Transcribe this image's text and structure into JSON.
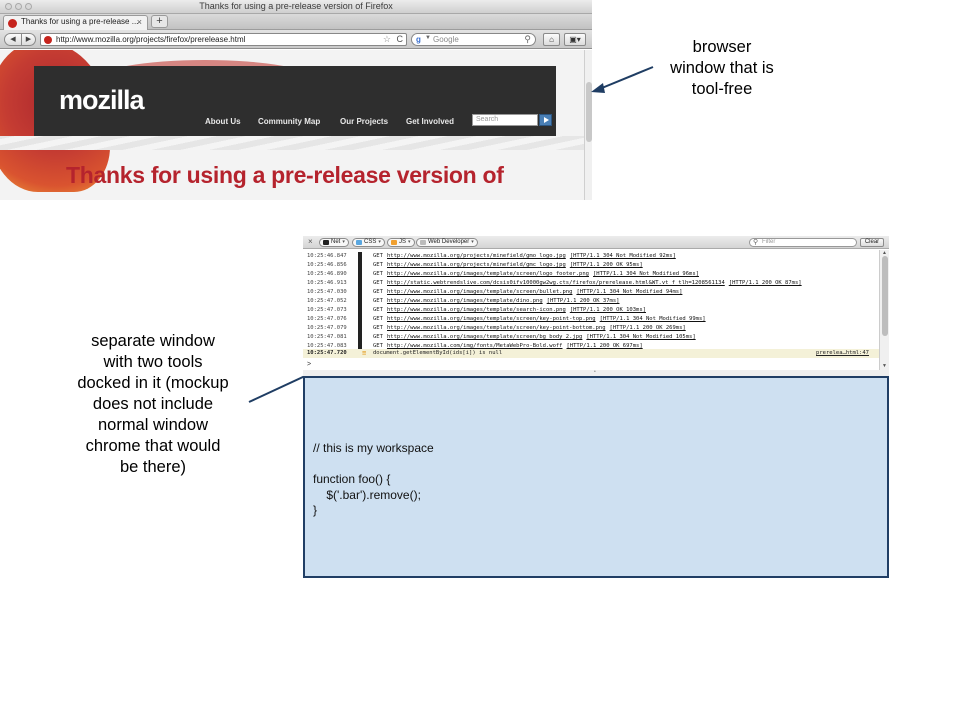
{
  "browser": {
    "window_title": "Thanks for using a pre-release version of Firefox",
    "tab_title": "Thanks for using a pre-release ...",
    "tab_close": "×",
    "new_tab": "+",
    "back": "◀",
    "forward": "▶",
    "url": "http://www.mozilla.org/projects/firefox/prerelease.html",
    "star": "☆",
    "reload": "C",
    "search_engine_icon": "g-icon",
    "search_placeholder": "Google",
    "home_icon": "⌂",
    "menu_icon": "▣▾",
    "page": {
      "logo": "mozilla",
      "nav": [
        "About Us",
        "Community Map",
        "Our Projects",
        "Get Involved"
      ],
      "search_placeholder": "Search",
      "heading": "Thanks for using a pre-release version of"
    }
  },
  "annotations": {
    "browser_lines": [
      "browser",
      "window that is",
      "tool-free"
    ],
    "separate_lines": [
      "separate window",
      "with two tools",
      "docked in it (mockup",
      "does not include",
      "normal window",
      "chrome that would",
      "be there)"
    ]
  },
  "devtools": {
    "close": "×",
    "filters": [
      {
        "label": "Net",
        "color": "#222222"
      },
      {
        "label": "CSS",
        "color": "#5aa7e0"
      },
      {
        "label": "JS",
        "color": "#f0a030"
      },
      {
        "label": "Web Developer",
        "color": "#bbbbbb"
      }
    ],
    "filter_placeholder": "Filter",
    "clear_label": "Clear",
    "log": [
      {
        "time": "10:25:46.847",
        "method": "GET",
        "url": "http://www.mozilla.org/projects/minefield/gmo_logo.jpg",
        "status": "[HTTP/1.1 304 Not Modified 92ms]"
      },
      {
        "time": "10:25:46.856",
        "method": "GET",
        "url": "http://www.mozilla.org/projects/minefield/gmc_logo.jpg",
        "status": "[HTTP/1.1 200 OK 95ms]"
      },
      {
        "time": "10:25:46.890",
        "method": "GET",
        "url": "http://www.mozilla.org/images/template/screen/logo_footer.png",
        "status": "[HTTP/1.1 304 Not Modified 96ms]"
      },
      {
        "time": "10:25:46.913",
        "method": "GET",
        "url": "http://static.webtrendslive.com/dcsis0ifv10000gw2wg.cts/firefox/prerelease.html&WT.vt_f_tlh=1208561134",
        "status": "[HTTP/1.1 200 OK 87ms]"
      },
      {
        "time": "10:25:47.030",
        "method": "GET",
        "url": "http://www.mozilla.org/images/template/screen/bullet.png",
        "status": "[HTTP/1.1 304 Not Modified 94ms]"
      },
      {
        "time": "10:25:47.052",
        "method": "GET",
        "url": "http://www.mozilla.org/images/template/dino.png",
        "status": "[HTTP/1.1 200 OK 37ms]"
      },
      {
        "time": "10:25:47.073",
        "method": "GET",
        "url": "http://www.mozilla.org/images/template/search-icon.png",
        "status": "[HTTP/1.1 200 OK 103ms]"
      },
      {
        "time": "10:25:47.076",
        "method": "GET",
        "url": "http://www.mozilla.org/images/template/screen/key-point-top.png",
        "status": "[HTTP/1.1 304 Not Modified 99ms]"
      },
      {
        "time": "10:25:47.079",
        "method": "GET",
        "url": "http://www.mozilla.org/images/template/screen/key-point-bottom.png",
        "status": "[HTTP/1.1 200 OK 269ms]"
      },
      {
        "time": "10:25:47.081",
        "method": "GET",
        "url": "http://www.mozilla.org/images/template/screen/bg_body_2.jpg",
        "status": "[HTTP/1.1 304 Not Modified 105ms]"
      },
      {
        "time": "10:25:47.083",
        "method": "GET",
        "url": "http://www.mozilla.com/img/fonts/MetaWebPro-Bold.woff",
        "status": "[HTTP/1.1 200 OK 697ms]"
      }
    ],
    "js_error": {
      "time": "10:25:47.720",
      "message": "document.getElementById(ids[i]) is null",
      "source": "prerelea…html:47"
    },
    "prompt": ">",
    "workspace_code": "// this is my workspace\n\nfunction foo() {\n    $('.bar').remove();\n}"
  },
  "colors": {
    "mozilla_red": "#b5232d",
    "workspace_bg": "#cee0f1",
    "workspace_border": "#203e65",
    "arrow": "#1f3d63"
  }
}
